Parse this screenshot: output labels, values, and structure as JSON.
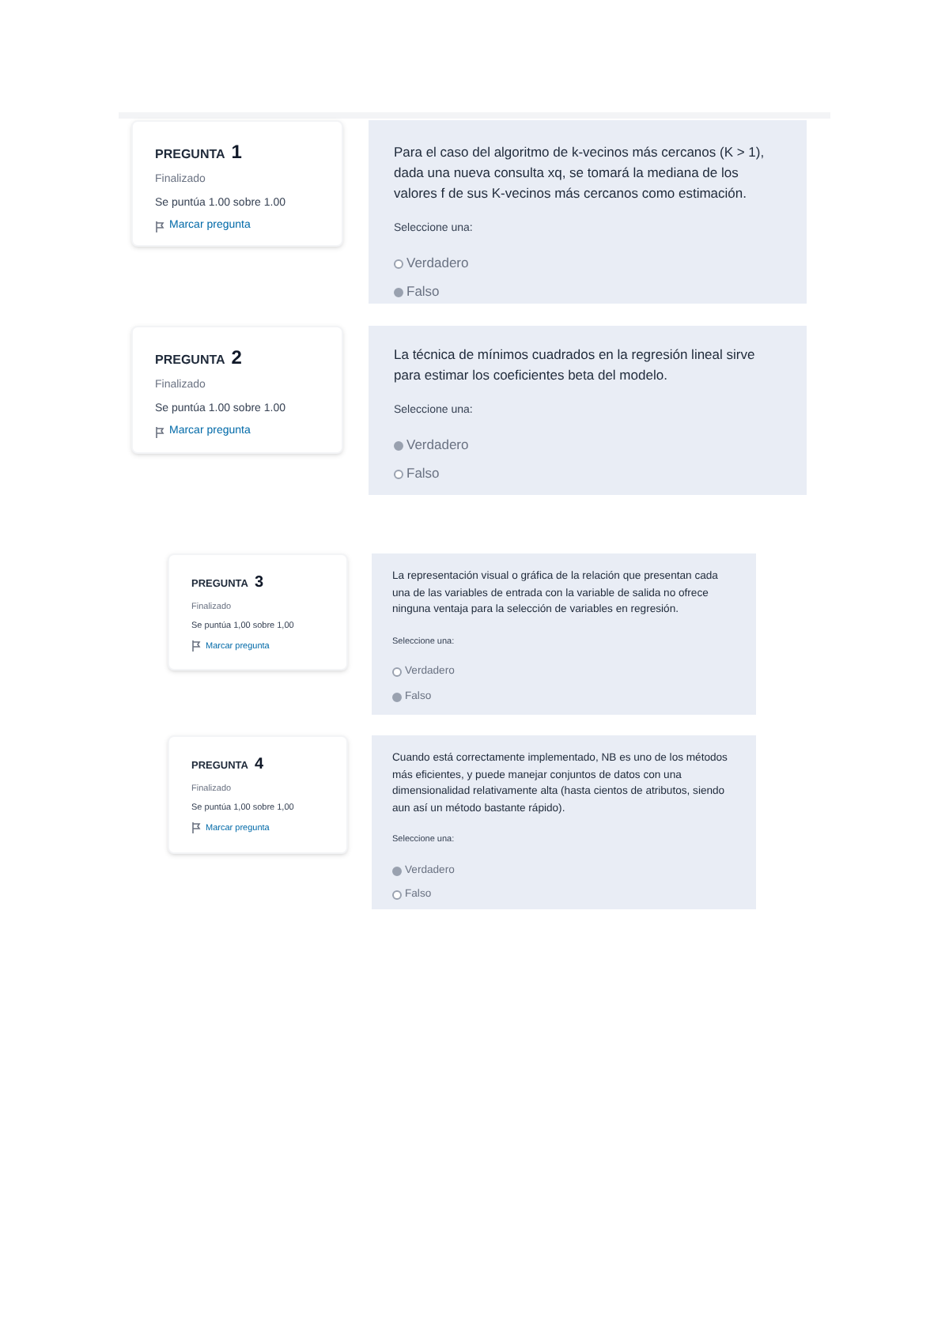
{
  "questions": [
    {
      "label": "PREGUNTA",
      "number": "1",
      "status": "Finalizado",
      "score": "Se puntúa 1.00 sobre 1.00",
      "flag": "Marcar pregunta",
      "text": "Para el caso del algoritmo de k-vecinos más cercanos (K > 1), dada una nueva consulta xq, se tomará la mediana de los valores f de sus K-vecinos más cercanos como estimación.",
      "prompt": "Seleccione una:",
      "options": [
        {
          "label": "Verdadero",
          "selected": false
        },
        {
          "label": "Falso",
          "selected": true
        }
      ]
    },
    {
      "label": "PREGUNTA",
      "number": "2",
      "status": "Finalizado",
      "score": "Se puntúa 1.00 sobre 1.00",
      "flag": "Marcar pregunta",
      "text": "La técnica de mínimos cuadrados en la regresión lineal sirve para estimar los coeficientes beta del modelo.",
      "prompt": "Seleccione una:",
      "options": [
        {
          "label": "Verdadero",
          "selected": true
        },
        {
          "label": "Falso",
          "selected": false
        }
      ]
    },
    {
      "label": "PREGUNTA",
      "number": "3",
      "status": "Finalizado",
      "score": "Se puntúa 1,00 sobre 1,00",
      "flag": "Marcar pregunta",
      "text": "La representación visual o gráfica de la relación que presentan cada una de las variables de entrada con la variable de salida no ofrece ninguna ventaja para la selección de variables en regresión.",
      "prompt": "Seleccione una:",
      "options": [
        {
          "label": "Verdadero",
          "selected": false
        },
        {
          "label": "Falso",
          "selected": true
        }
      ]
    },
    {
      "label": "PREGUNTA",
      "number": "4",
      "status": "Finalizado",
      "score": "Se puntúa 1,00 sobre 1,00",
      "flag": "Marcar pregunta",
      "text": "Cuando está correctamente implementado, NB es uno de los métodos más eficientes, y puede manejar conjuntos de datos con una dimensionalidad relativamente alta (hasta cientos de atributos, siendo aun así un método bastante rápido).",
      "prompt": "Seleccione una:",
      "options": [
        {
          "label": "Verdadero",
          "selected": true
        },
        {
          "label": "Falso",
          "selected": false
        }
      ]
    }
  ]
}
